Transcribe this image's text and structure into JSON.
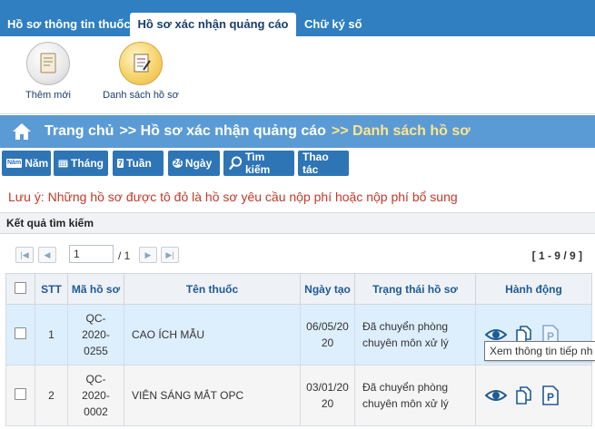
{
  "tabs": [
    {
      "label": "Hồ sơ thông tin thuốc"
    },
    {
      "label": "Hồ sơ xác nhận quảng cáo"
    },
    {
      "label": "Chữ ký số"
    }
  ],
  "ribbon": {
    "new_label": "Thêm mới",
    "list_label": "Danh sách hồ sơ"
  },
  "breadcrumb": {
    "home": "Trang chủ",
    "level1": ">> Hồ sơ xác nhận quảng cáo",
    "level2": ">> Danh sách hồ sơ"
  },
  "filters": {
    "year": {
      "label": "Năm",
      "icon_text": "Năm"
    },
    "month": {
      "label": "Tháng"
    },
    "week": {
      "label": "Tuần",
      "icon_text": "7"
    },
    "day": {
      "label": "Ngày",
      "icon_text": "24"
    },
    "search": {
      "label": "Tìm kiếm"
    },
    "actions": {
      "label": "Thao tác"
    }
  },
  "note": "Lưu ý: Những hồ sơ được tô đỏ là hồ sơ yêu cầu nộp phí hoặc nộp phí bổ sung",
  "results_title": "Kết quả tìm kiếm",
  "pager": {
    "page_value": "1",
    "of_text": "/ 1",
    "count_text": "[ 1 - 9 / 9 ]"
  },
  "table": {
    "headers": [
      "STT",
      "Mã hồ sơ",
      "Tên thuốc",
      "Ngày tạo",
      "Trạng thái hồ sơ",
      "Hành động"
    ],
    "rows": [
      {
        "stt": "1",
        "ma": [
          "QC-",
          "2020-",
          "0255"
        ],
        "ten": "CAO ÍCH MẪU",
        "ngay": [
          "06/05/20",
          "20"
        ],
        "trang_thai": [
          "Đã chuyển phòng",
          "chuyên môn xử lý"
        ]
      },
      {
        "stt": "2",
        "ma": [
          "QC-",
          "2020-",
          "0002"
        ],
        "ten": "VIÊN SÁNG MẮT OPC",
        "ngay": [
          "03/01/20",
          "20"
        ],
        "trang_thai": [
          "Đã chuyển phòng",
          "chuyên môn xử lý"
        ]
      }
    ]
  },
  "tooltip": "Xem thông tin tiếp nh",
  "colors": {
    "tabbar": "#2f7fc1",
    "breadcrumb": "#5b9bd5",
    "filter_button": "#2e75b6",
    "note": "#c0392b",
    "selected_row": "#ddeefd"
  },
  "icons": [
    "home-icon",
    "new-document-icon",
    "document-list-icon",
    "calendar-year-icon",
    "calendar-month-icon",
    "calendar-week-icon",
    "clock-24-icon",
    "magnifier-icon",
    "eye-icon",
    "copy-icon",
    "p-document-icon"
  ]
}
